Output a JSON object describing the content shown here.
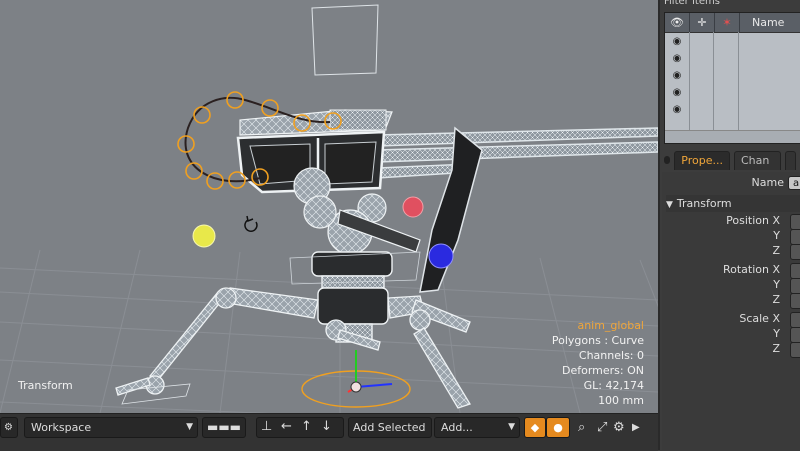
{
  "viewport": {
    "label": "Transform",
    "info": {
      "item": "anim_global",
      "polygons": "Polygons : Curve",
      "channels": "Channels: 0",
      "deformers": "Deformers: ON",
      "gl": "GL: 42,174",
      "grid": "100 mm"
    }
  },
  "items_panel": {
    "title": "Filter Items",
    "name_header": "Name",
    "row_count": 5
  },
  "properties_panel": {
    "tabs": [
      "Prope...",
      "Chan ...",
      ""
    ],
    "name_label": "Name",
    "name_value": "a",
    "section": "Transform",
    "position_label": "Position X",
    "rotation_label": "Rotation X",
    "scale_label": "Scale X",
    "y_label": "Y",
    "z_label": "Z"
  },
  "toolbar": {
    "workspace": "Workspace",
    "add_selected": "Add Selected",
    "add": "Add..."
  },
  "colors": {
    "accent": "#f0a63a",
    "viewport_bg": "#7d8186",
    "panel_bg": "#3c3c3c",
    "selection_blue": "#2a2ae0",
    "yellow_handle": "#e8e84a",
    "red_handle": "#e05060"
  }
}
